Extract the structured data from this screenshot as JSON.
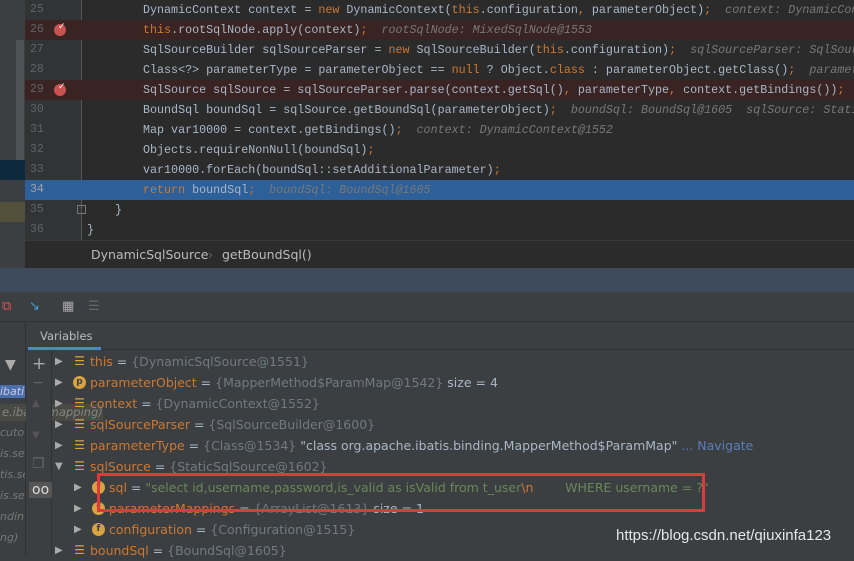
{
  "editor": {
    "lines": [
      {
        "num": "25",
        "bp": false,
        "segs": [
          [
            "tx",
            "DynamicContext context = "
          ],
          [
            "kw",
            "new "
          ],
          [
            "tx",
            "DynamicContext("
          ],
          [
            "kw",
            "this"
          ],
          [
            "tx",
            ".configuration"
          ],
          [
            "kw",
            ", "
          ],
          [
            "tx",
            "parameterObject)"
          ],
          [
            "kw",
            ";"
          ],
          [
            "hint",
            "  context: DynamicCon"
          ]
        ]
      },
      {
        "num": "26",
        "bp": true,
        "segs": [
          [
            "kw",
            "this"
          ],
          [
            "tx",
            ".rootSqlNode.apply(context)"
          ],
          [
            "kw",
            ";"
          ],
          [
            "hint",
            "  rootSqlNode: MixedSqlNode@1553"
          ]
        ]
      },
      {
        "num": "27",
        "bp": false,
        "segs": [
          [
            "tx",
            "SqlSourceBuilder sqlSourceParser = "
          ],
          [
            "kw",
            "new "
          ],
          [
            "tx",
            "SqlSourceBuilder("
          ],
          [
            "kw",
            "this"
          ],
          [
            "tx",
            ".configuration)"
          ],
          [
            "kw",
            ";"
          ],
          [
            "hint",
            "  sqlSourceParser: SqlSour"
          ]
        ]
      },
      {
        "num": "28",
        "bp": false,
        "segs": [
          [
            "tx",
            "Class<?> parameterType = parameterObject == "
          ],
          [
            "kw",
            "null"
          ],
          [
            "tx",
            " ? Object."
          ],
          [
            "kw",
            "class"
          ],
          [
            "tx",
            " : parameterObject.getClass()"
          ],
          [
            "kw",
            ";"
          ],
          [
            "hint",
            "  paramet"
          ]
        ]
      },
      {
        "num": "29",
        "bp": true,
        "segs": [
          [
            "tx",
            "SqlSource sqlSource = sqlSourceParser.parse(context.getSql()"
          ],
          [
            "kw",
            ", "
          ],
          [
            "tx",
            "parameterType"
          ],
          [
            "kw",
            ", "
          ],
          [
            "tx",
            "context.getBindings())"
          ],
          [
            "kw",
            ";"
          ]
        ]
      },
      {
        "num": "30",
        "bp": false,
        "segs": [
          [
            "tx",
            "BoundSql boundSql = sqlSource.getBoundSql(parameterObject)"
          ],
          [
            "kw",
            ";"
          ],
          [
            "hint",
            "  boundSql: BoundSql@1605  sqlSource: Stati"
          ]
        ]
      },
      {
        "num": "31",
        "bp": false,
        "segs": [
          [
            "tx",
            "Map var10000 = context.getBindings()"
          ],
          [
            "kw",
            ";"
          ],
          [
            "hint",
            "  context: DynamicContext@1552"
          ]
        ]
      },
      {
        "num": "32",
        "bp": false,
        "segs": [
          [
            "tx",
            "Objects.requireNonNull(boundSql)"
          ],
          [
            "kw",
            ";"
          ]
        ]
      },
      {
        "num": "33",
        "bp": false,
        "segs": [
          [
            "tx",
            "var10000.forEach(boundSql::setAdditionalParameter)"
          ],
          [
            "kw",
            ";"
          ]
        ]
      },
      {
        "num": "34",
        "bp": false,
        "current": true,
        "segs": [
          [
            "kw",
            "return "
          ],
          [
            "tx",
            "boundSql"
          ],
          [
            "kw",
            ";"
          ],
          [
            "hint",
            "  boundSql: BoundSql@1605"
          ]
        ]
      },
      {
        "num": "35",
        "bp": false,
        "indent": "    ",
        "segs": [
          [
            "tx",
            "}"
          ]
        ]
      },
      {
        "num": "36",
        "bp": false,
        "indent": "",
        "segs": [
          [
            "tx",
            "}"
          ]
        ]
      }
    ]
  },
  "breadcrumb": {
    "class": "DynamicSqlSource",
    "sep": "›",
    "method": "getBoundSql()"
  },
  "variables": {
    "tab": "Variables",
    "rows": [
      {
        "level": 0,
        "expanded": false,
        "icon": "list",
        "name": "this",
        "value": "{DynamicSqlSource@1551}"
      },
      {
        "level": 0,
        "expanded": false,
        "icon": "p",
        "name": "parameterObject",
        "value": "{MapperMethod$ParamMap@1542}",
        "extra": "size = 4"
      },
      {
        "level": 0,
        "expanded": false,
        "icon": "list",
        "name": "context",
        "value": "{DynamicContext@1552}"
      },
      {
        "level": 0,
        "expanded": false,
        "icon": "list",
        "name": "sqlSourceParser",
        "value": "{SqlSourceBuilder@1600}"
      },
      {
        "level": 0,
        "expanded": false,
        "icon": "list",
        "name": "parameterType",
        "value": "{Class@1534}",
        "extra": "\"class org.apache.ibatis.binding.MapperMethod$ParamMap\"",
        "link": "... Navigate"
      },
      {
        "level": 0,
        "expanded": true,
        "icon": "list",
        "name": "sqlSource",
        "value": "{StaticSqlSource@1602}"
      },
      {
        "level": 1,
        "expanded": false,
        "icon": "f",
        "name": "sql",
        "str1": "\"select id,username,password,is_valid as isValid from t_user",
        "esc": "\\n",
        "str2": "        WHERE username = ?\""
      },
      {
        "level": 1,
        "expanded": false,
        "icon": "f",
        "name": "parameterMappings",
        "value": "{ArrayList@1613}",
        "extra": "size = 1"
      },
      {
        "level": 1,
        "expanded": false,
        "icon": "f",
        "name": "configuration",
        "value": "{Configuration@1515}"
      },
      {
        "level": 0,
        "expanded": false,
        "icon": "list",
        "name": "boundSql",
        "value": "{BoundSql@1605}"
      }
    ]
  },
  "frames": [
    "ibati",
    "cuto",
    "is.se",
    "tis.se",
    "is.se",
    "ndin",
    "ng)"
  ],
  "tooltip": "e.ibatis.mapping)",
  "watermark": "https://blog.csdn.net/qiuxinfa123",
  "colors": {
    "highlight": "#e0393a",
    "current_line": "#2d5f99",
    "keyword": "#cc7832"
  }
}
